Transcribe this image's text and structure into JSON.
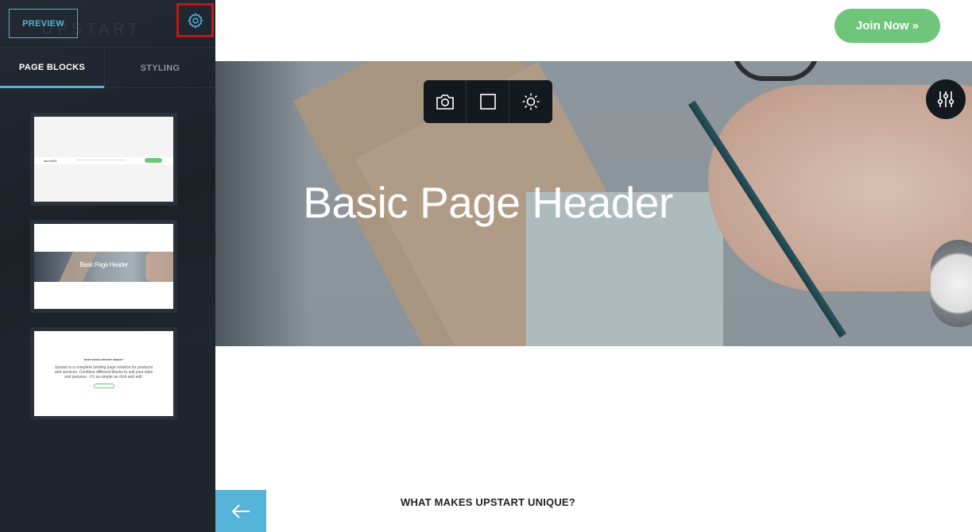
{
  "sidebar": {
    "brand_watermark": "UPSTART",
    "preview_label": "PREVIEW",
    "settings_icon": "gear-icon",
    "tabs": [
      {
        "label": "PAGE BLOCKS",
        "active": true
      },
      {
        "label": "STYLING",
        "active": false
      }
    ],
    "thumbnails": [
      {
        "logo": "launchKit"
      },
      {
        "title": "Basic Page Header"
      },
      {
        "heading": "WHAT MAKES UPSTART UNIQUE?",
        "text": "Upstart is a complete landing page solution for products and services. Combine different blocks to suit your style and purpose - it's as simple as click and edit."
      }
    ]
  },
  "main": {
    "join_label": "Join Now »",
    "hero": {
      "title": "Basic Page Header",
      "toolbar": [
        "camera-icon",
        "square-icon",
        "sun-icon"
      ],
      "adjust_icon": "sliders-icon"
    },
    "back_icon": "arrow-left-icon",
    "section_heading": "WHAT MAKES UPSTART UNIQUE?"
  },
  "colors": {
    "sidebar_bg": "#1f242d",
    "accent_blue": "#4fb3d9",
    "join_green": "#6fc579",
    "highlight_red": "#c01818",
    "toolbar_bg": "#14191f"
  }
}
